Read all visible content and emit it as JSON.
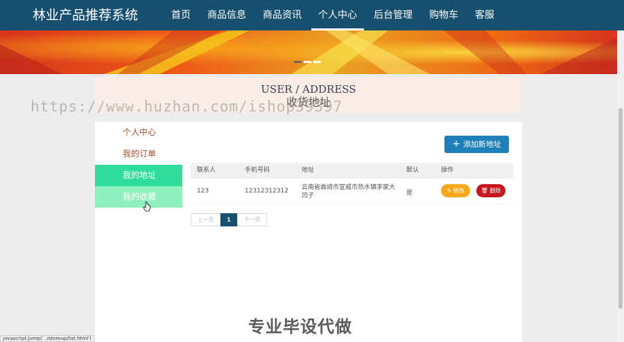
{
  "header": {
    "brand": "林业产品推荐系统",
    "nav": [
      {
        "label": "首页",
        "active": false
      },
      {
        "label": "商品信息",
        "active": false
      },
      {
        "label": "商品资讯",
        "active": false
      },
      {
        "label": "个人中心",
        "active": true
      },
      {
        "label": "后台管理",
        "active": false
      },
      {
        "label": "购物车",
        "active": false
      },
      {
        "label": "客服",
        "active": false
      }
    ]
  },
  "banner": {
    "slide_count": 3,
    "active_slide": 1
  },
  "section": {
    "title_en": "USER / ADDRESS",
    "title_cn": "收货地址"
  },
  "watermark": "https://www.huzhan.com/ishop39397",
  "sidebar": {
    "items": [
      {
        "label": "个人中心",
        "state": "normal"
      },
      {
        "label": "我的订单",
        "state": "normal"
      },
      {
        "label": "我的地址",
        "state": "active"
      },
      {
        "label": "我的收藏",
        "state": "hover"
      }
    ]
  },
  "toolbar": {
    "add_label": "添加新地址"
  },
  "table": {
    "headers": {
      "contact": "联系人",
      "phone": "手机号码",
      "address": "地址",
      "default": "默认",
      "actions": "操作"
    },
    "rows": [
      {
        "contact": "123",
        "phone": "12312312312",
        "address": "云南省曲靖市宣威市热水镇李家大凹子",
        "default": "是",
        "edit_label": "修改",
        "delete_label": "删除"
      }
    ]
  },
  "pagination": {
    "prev": "上一页",
    "current": "1",
    "next": "下一页"
  },
  "bottom_watermark": "专业毕设代做",
  "status_bar": "javascript:jump('../storeup/list.html')",
  "colors": {
    "nav_bg": "#17506e",
    "side_active": "#2fdc9c",
    "side_hover": "#8ff0bd",
    "add_button": "#1f7fb8",
    "edit_button": "#f7a81b",
    "delete_button": "#c8161e"
  }
}
